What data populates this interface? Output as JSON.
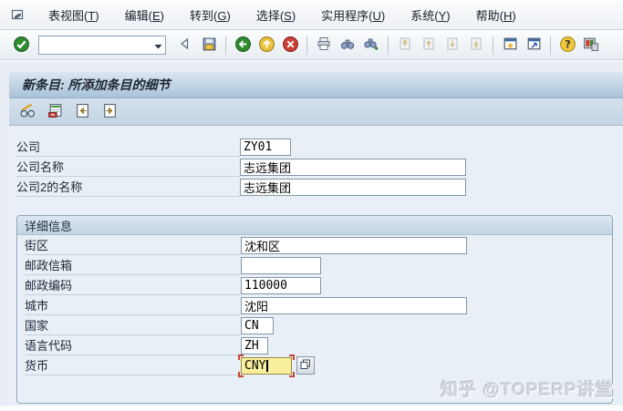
{
  "menu_bar": {
    "items": [
      {
        "pre": "表视图(",
        "key": "T",
        "post": ")"
      },
      {
        "pre": "编辑(",
        "key": "E",
        "post": ")"
      },
      {
        "pre": "转到(",
        "key": "G",
        "post": ")"
      },
      {
        "pre": "选择(",
        "key": "S",
        "post": ")"
      },
      {
        "pre": "实用程序(",
        "key": "U",
        "post": ")"
      },
      {
        "pre": "系统(",
        "key": "Y",
        "post": ")"
      },
      {
        "pre": "帮助(",
        "key": "H",
        "post": ")"
      }
    ]
  },
  "toolbar": {
    "command_field": {
      "value": "",
      "placeholder": ""
    },
    "buttons": [
      "enter",
      "command-dropdown",
      "back-triangle",
      "save",
      "back",
      "exit",
      "cancel",
      "print",
      "find",
      "find-next",
      "first-page",
      "previous-page",
      "next-page",
      "last-page",
      "new-session",
      "create-shortcut",
      "help",
      "customize-layout"
    ]
  },
  "title_bar": {
    "title": "新条目: 所添加条目的细节"
  },
  "app_toolbar": {
    "buttons": [
      "display-change-toggle",
      "delete-row",
      "previous-entry",
      "next-entry"
    ]
  },
  "form": {
    "fields": [
      {
        "label": "公司",
        "value": "ZY01"
      },
      {
        "label": "公司名称",
        "value": "志远集团"
      },
      {
        "label": "公司2的名称",
        "value": "志远集团"
      }
    ],
    "group": {
      "title": "详细信息",
      "fields": [
        {
          "label": "街区",
          "value": "沈和区"
        },
        {
          "label": "邮政信箱",
          "value": ""
        },
        {
          "label": "邮政编码",
          "value": "110000"
        },
        {
          "label": "城市",
          "value": "沈阳"
        },
        {
          "label": "国家",
          "value": "CN"
        },
        {
          "label": "语言代码",
          "value": "ZH"
        },
        {
          "label": "货币",
          "value": "CNY"
        }
      ]
    }
  },
  "watermark": {
    "text": "知乎 @TOPERP讲堂"
  },
  "colors": {
    "focus_field_bg": "#f9ef9e",
    "focus_marker": "#c64338",
    "title_gradient_top": "#dce6f0",
    "title_gradient_bottom": "#a8c3da",
    "main_bg": "#e9eff6"
  }
}
